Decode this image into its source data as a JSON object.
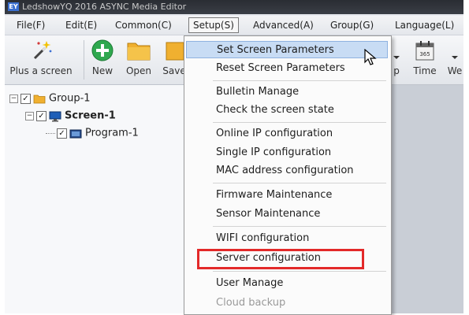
{
  "window": {
    "title": "LedshowYQ 2016 ASYNC Media Editor"
  },
  "menubar": {
    "items": [
      {
        "label": "File(F)"
      },
      {
        "label": "Edit(E)"
      },
      {
        "label": "Common(C)"
      },
      {
        "label": "Setup(S)"
      },
      {
        "label": "Advanced(A)"
      },
      {
        "label": "Group(G)"
      },
      {
        "label": "Language(L)"
      }
    ],
    "active": "Setup(S)"
  },
  "toolbar": {
    "plus_screen_label": "Plus a screen",
    "new_label": "New",
    "open_label": "Open",
    "save_label": "Save",
    "time_label": "Time",
    "we_label": "We",
    "p_label": "p",
    "colors": {
      "new": "#2fa84f",
      "folder": "#f0b030",
      "time": "#e0e0e0"
    }
  },
  "tree": {
    "group": {
      "label": "Group-1",
      "checked": true,
      "expanded": true
    },
    "screen": {
      "label": "Screen-1",
      "checked": true,
      "expanded": true
    },
    "program": {
      "label": "Program-1",
      "checked": true
    }
  },
  "setup_menu": {
    "items": [
      {
        "label": "Set Screen Parameters",
        "state": "highlighted"
      },
      {
        "label": "Reset Screen Parameters",
        "state": "normal"
      },
      {
        "label": "Bulletin Manage",
        "state": "normal"
      },
      {
        "label": "Check the screen state",
        "state": "normal"
      },
      {
        "label": "Online IP configuration",
        "state": "normal"
      },
      {
        "label": "Single IP configuration",
        "state": "normal"
      },
      {
        "label": "MAC address configuration",
        "state": "normal"
      },
      {
        "label": "Firmware Maintenance",
        "state": "normal"
      },
      {
        "label": "Sensor Maintenance",
        "state": "normal"
      },
      {
        "label": "WIFI configuration",
        "state": "normal"
      },
      {
        "label": "Server configuration",
        "state": "normal",
        "annotated": true
      },
      {
        "label": "User Manage",
        "state": "normal"
      },
      {
        "label": "Cloud backup",
        "state": "disabled"
      }
    ],
    "annotation_color": "#e32929",
    "highlight_color": "#c8dcf4"
  }
}
